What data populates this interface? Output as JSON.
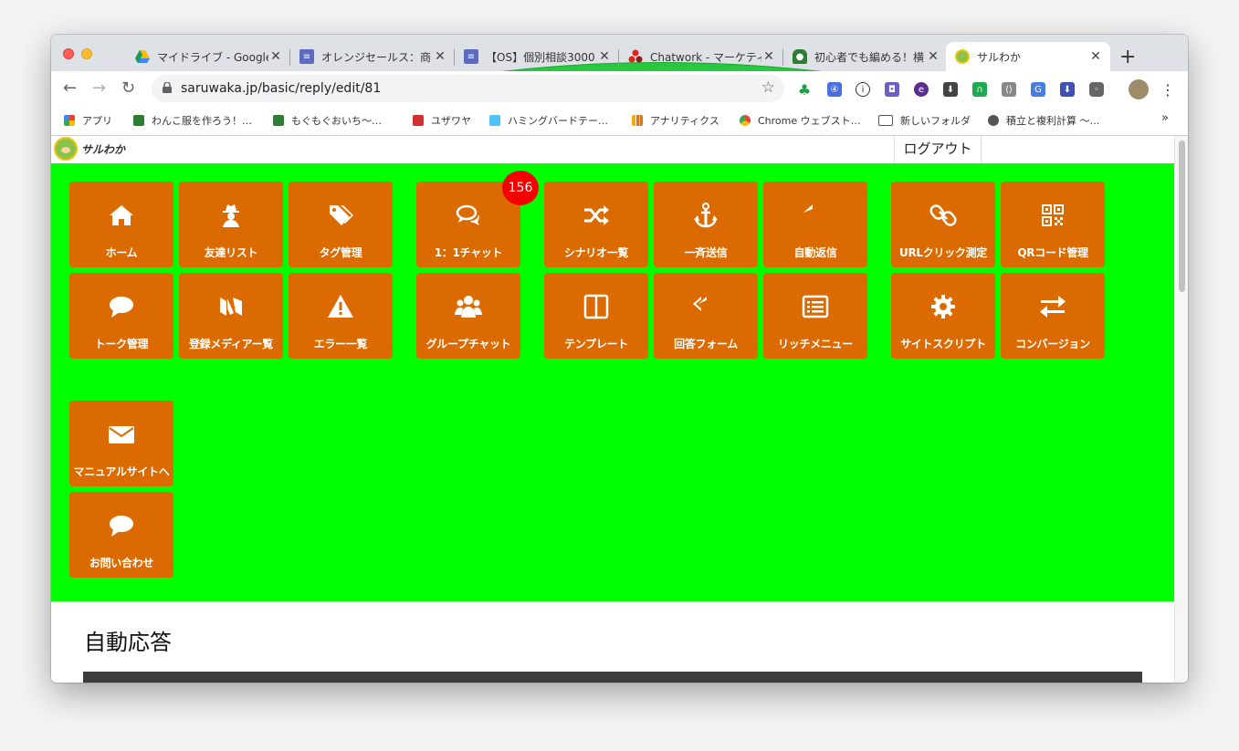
{
  "browser": {
    "tabs": [
      {
        "title": "マイドライブ - Google",
        "favicon": "google-drive-icon",
        "color": "#4285f4"
      },
      {
        "title": "オレンジセールス：商",
        "favicon": "google-docs-icon",
        "color": "#5c6bc0"
      },
      {
        "title": "【OS】個別相談3000",
        "favicon": "google-docs-icon",
        "color": "#5c6bc0"
      },
      {
        "title": "Chatwork - マーケティ",
        "favicon": "chatwork-icon",
        "color": "#e2231a"
      },
      {
        "title": "初心者でも編める！横",
        "favicon": "green-owl-icon",
        "color": "#2e7d32"
      },
      {
        "title": "サルわか",
        "favicon": "saruwaka-icon",
        "color": "#8bc34a"
      }
    ],
    "url": "saruwaka.jp/basic/reply/edit/81",
    "bookmarks": [
      {
        "label": "アプリ",
        "icon": "apps-grid-icon"
      },
      {
        "label": "わんこ服を作ろう！…",
        "icon": "green-owl-icon"
      },
      {
        "label": "もぐもぐおいち〜…",
        "icon": "green-owl-icon"
      },
      {
        "label": "ユザワヤ",
        "icon": "yuzawaya-icon"
      },
      {
        "label": "ハミングバードテー…",
        "icon": "hummingbird-icon"
      },
      {
        "label": "アナリティクス",
        "icon": "analytics-icon"
      },
      {
        "label": "Chrome ウェブスト…",
        "icon": "chrome-webstore-icon"
      },
      {
        "label": "新しいフォルダ",
        "icon": "folder-icon"
      },
      {
        "label": "積立と複利計算 〜…",
        "icon": "globe-icon"
      }
    ]
  },
  "site": {
    "logo_text": "サルわか",
    "logout_label": "ログアウト",
    "chat_badge": "156",
    "menu": [
      {
        "label": "ホーム",
        "icon": "home-icon"
      },
      {
        "label": "友達リスト",
        "icon": "user-secret-icon"
      },
      {
        "label": "タグ管理",
        "icon": "tags-icon"
      },
      {
        "label": "1：1チャット",
        "icon": "comments-icon"
      },
      {
        "label": "シナリオ一覧",
        "icon": "random-icon"
      },
      {
        "label": "一斉送信",
        "icon": "anchor-icon"
      },
      {
        "label": "自動返信",
        "icon": "reply-icon"
      },
      {
        "label": "URLクリック測定",
        "icon": "link-icon"
      },
      {
        "label": "QRコード管理",
        "icon": "qrcode-icon"
      },
      {
        "label": "トーク管理",
        "icon": "comment-icon"
      },
      {
        "label": "登録メディアー覧",
        "icon": "medium-icon"
      },
      {
        "label": "エラー一覧",
        "icon": "warning-icon"
      },
      {
        "label": "グループチャット",
        "icon": "users-icon"
      },
      {
        "label": "テンプレート",
        "icon": "columns-icon"
      },
      {
        "label": "回答フォーム",
        "icon": "reply-all-icon"
      },
      {
        "label": "リッチメニュー",
        "icon": "list-alt-icon"
      },
      {
        "label": "サイトスクリプト",
        "icon": "gear-icon"
      },
      {
        "label": "コンバージョン",
        "icon": "exchange-icon"
      },
      {
        "label": "マニュアルサイトへ",
        "icon": "envelope-icon"
      },
      {
        "label": "お問い合わせ",
        "icon": "comment-icon"
      }
    ],
    "section_title": "自動応答"
  }
}
